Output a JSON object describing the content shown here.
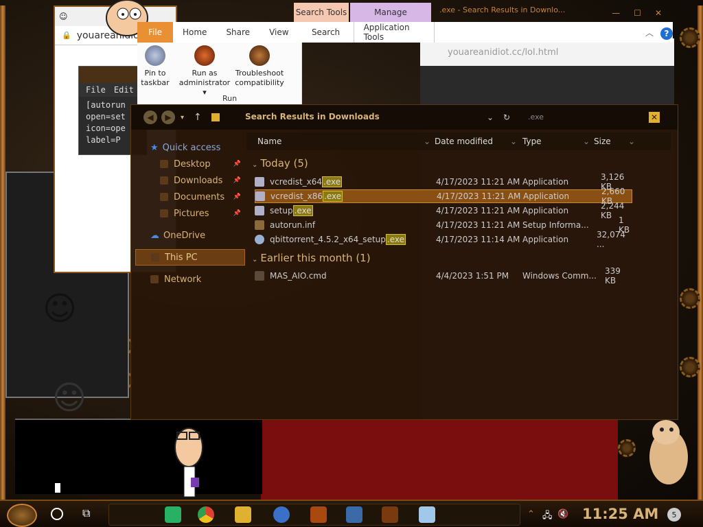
{
  "background": {
    "browser_tab": "youareanidiot",
    "browser_url": "youareanidiot",
    "notepad_menu": [
      "File",
      "Edit"
    ],
    "notepad_lines": [
      "[autorun",
      "open=set",
      "icon=ope",
      "label=P"
    ],
    "right_url": "youareanidiot.cc/lol.html",
    "right_title": ".exe - Search Results in Downlo..."
  },
  "ribbon": {
    "context_tabs": {
      "search": "Search Tools",
      "manage": "Manage"
    },
    "tabs": [
      "File",
      "Home",
      "Share",
      "View",
      "Search",
      "Application Tools"
    ],
    "buttons": [
      {
        "label1": "Pin to",
        "label2": "taskbar"
      },
      {
        "label1": "Run as",
        "label2": "administrator"
      },
      {
        "label1": "Troubleshoot",
        "label2": "compatibility"
      }
    ],
    "group_label": "Run",
    "help": "?"
  },
  "explorer": {
    "address": "Search Results in Downloads",
    "search_value": ".exe",
    "close": "✕",
    "nav": {
      "quick_access": "Quick access",
      "desktop": "Desktop",
      "downloads": "Downloads",
      "documents": "Documents",
      "pictures": "Pictures",
      "onedrive": "OneDrive",
      "this_pc": "This PC",
      "network": "Network"
    },
    "columns": {
      "name": "Name",
      "date": "Date modified",
      "type": "Type",
      "size": "Size"
    },
    "groups": [
      {
        "label": "Today (5)",
        "files": [
          {
            "base": "vcredist_x64",
            "ext": ".exe",
            "date": "4/17/2023 11:21 AM",
            "type": "Application",
            "size": "3,126 KB"
          },
          {
            "base": "vcredist_x86",
            "ext": ".exe",
            "date": "4/17/2023 11:21 AM",
            "type": "Application",
            "size": "2,660 KB"
          },
          {
            "base": "setup",
            "ext": ".exe",
            "date": "4/17/2023 11:21 AM",
            "type": "Application",
            "size": "2,244 KB"
          },
          {
            "base": "autorun.inf",
            "ext": "",
            "date": "4/17/2023 11:21 AM",
            "type": "Setup Informa...",
            "size": "1 KB"
          },
          {
            "base": "qbittorrent_4.5.2_x64_setup",
            "ext": ".exe",
            "date": "4/17/2023 11:14 AM",
            "type": "Application",
            "size": "32,074 ..."
          }
        ]
      },
      {
        "label": "Earlier this month (1)",
        "files": [
          {
            "base": "MAS_AIO.cmd",
            "ext": "",
            "date": "4/4/2023 1:51 PM",
            "type": "Windows Comm...",
            "size": "339 KB"
          }
        ]
      }
    ]
  },
  "taskbar": {
    "time": "11:25 AM",
    "notifications": "5",
    "icons": [
      "task-view-icon",
      "chat-icon",
      "chrome-icon",
      "file-explorer-icon",
      "qbittorrent-icon",
      "xd-icon",
      "virtualbox-icon",
      "app-icon",
      "notepad-icon"
    ]
  },
  "colors": {
    "accent": "#e89033",
    "gold": "#d8b478",
    "selection": "#8a4f12",
    "highlight": "#d8c030"
  }
}
